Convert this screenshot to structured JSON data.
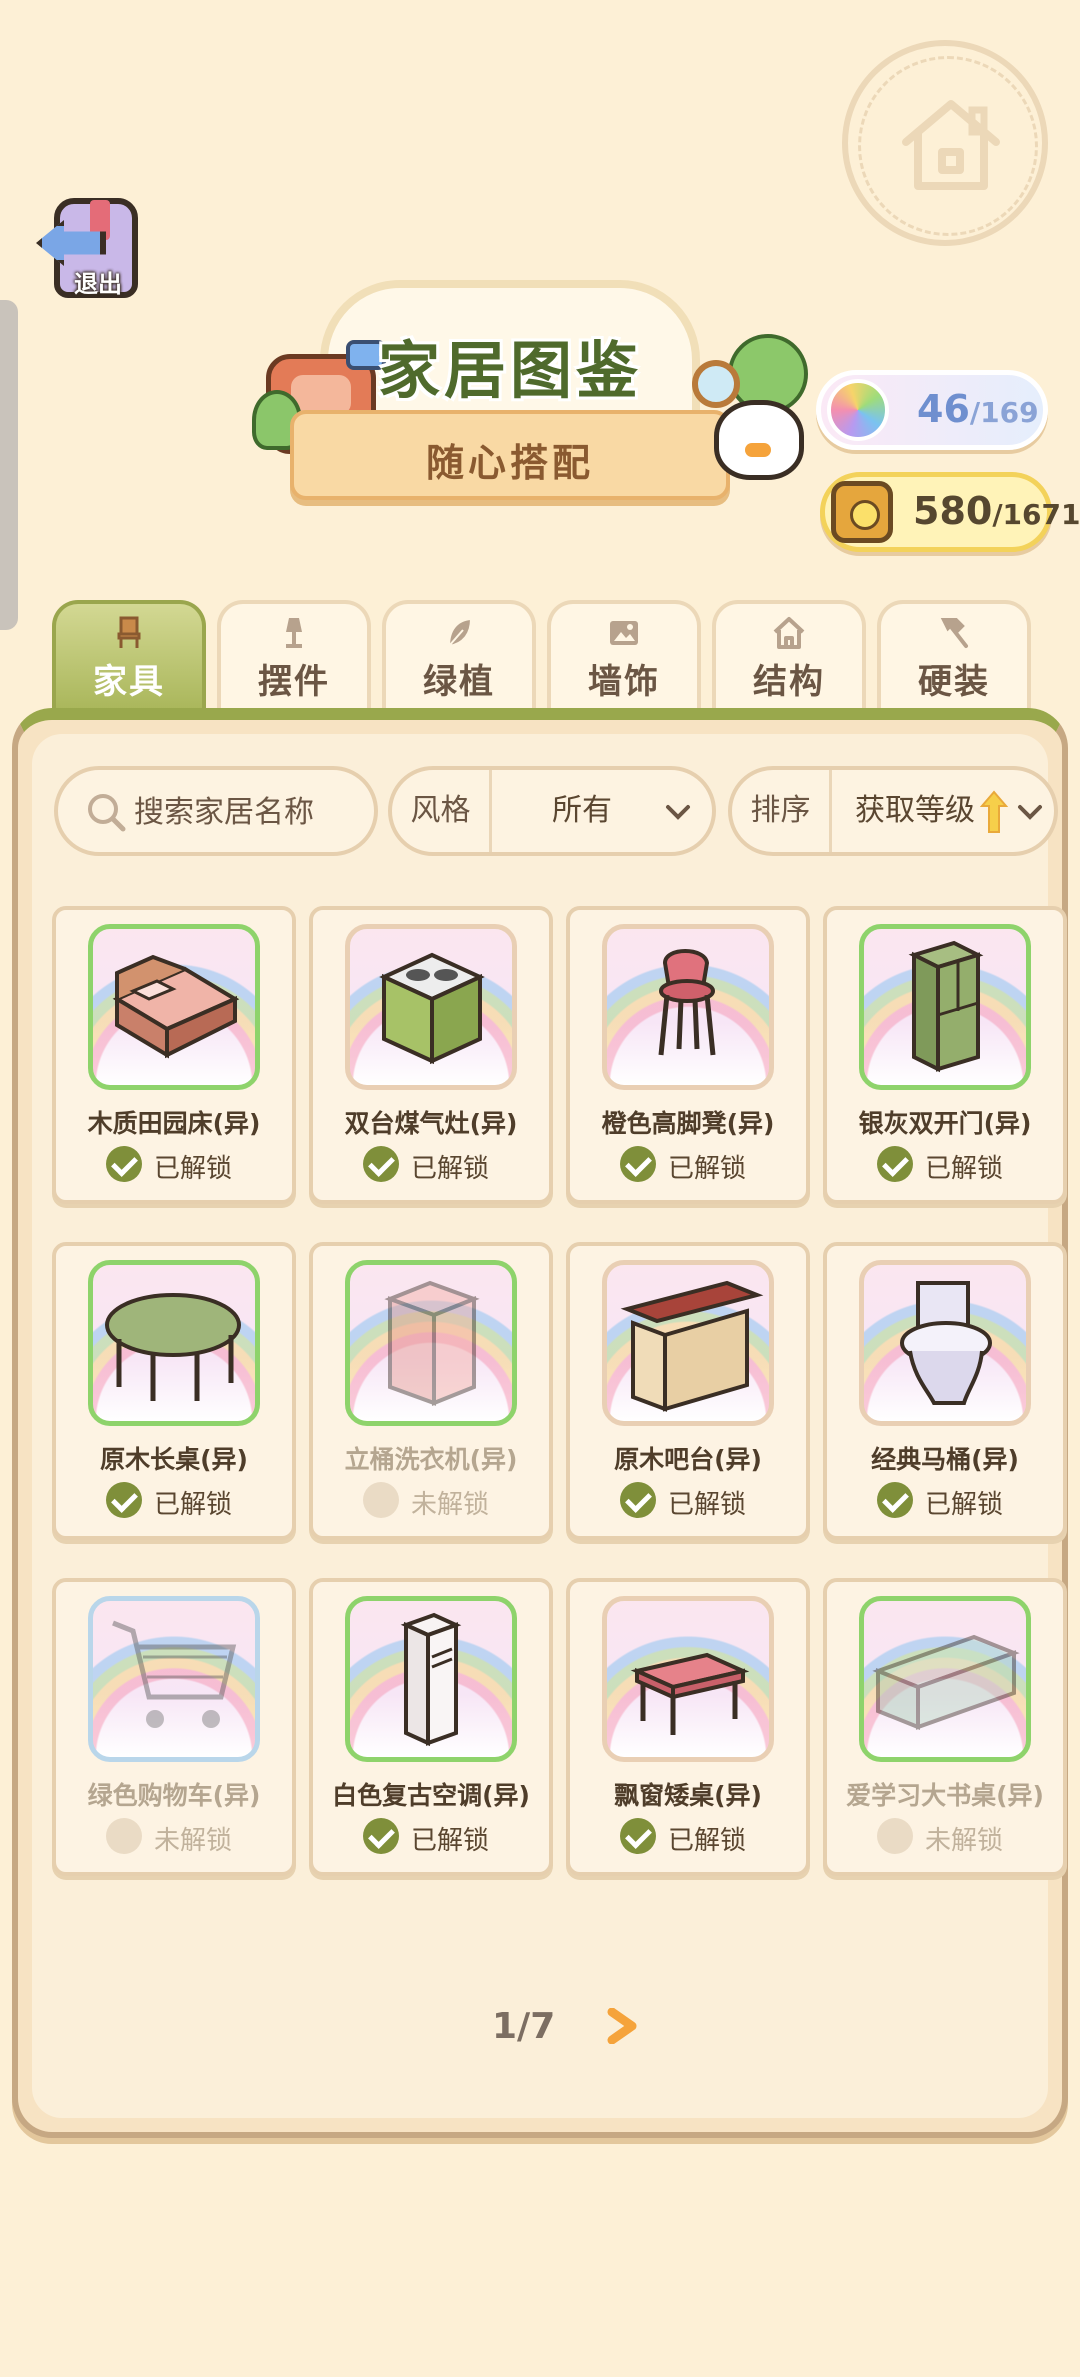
{
  "header": {
    "exit_label": "退出",
    "title": "家居图鉴",
    "subtitle": "随心搭配"
  },
  "counters": {
    "rainbow": {
      "value": "46",
      "total": "/169"
    },
    "coins": {
      "value": "580",
      "total": "/1671"
    }
  },
  "tabs": [
    {
      "label": "家具",
      "icon": "chair-icon",
      "active": true
    },
    {
      "label": "摆件",
      "icon": "lamp-icon",
      "active": false
    },
    {
      "label": "绿植",
      "icon": "leaf-icon",
      "active": false
    },
    {
      "label": "墙饰",
      "icon": "picture-frame-icon",
      "active": false
    },
    {
      "label": "结构",
      "icon": "house-icon",
      "active": false
    },
    {
      "label": "硬装",
      "icon": "hammer-icon",
      "active": false
    }
  ],
  "filters": {
    "search_placeholder": "搜索家居名称",
    "style_label": "风格",
    "style_value": "所有",
    "sort_label": "排序",
    "sort_value": "获取等级"
  },
  "items": [
    {
      "name": "木质田园床(异)",
      "status": "已解锁",
      "unlocked": true,
      "icon": "bed-icon"
    },
    {
      "name": "双台煤气灶(异)",
      "status": "已解锁",
      "unlocked": true,
      "icon": "stove-icon"
    },
    {
      "name": "橙色高脚凳(异)",
      "status": "已解锁",
      "unlocked": true,
      "icon": "stool-icon"
    },
    {
      "name": "银灰双开门(异)",
      "status": "已解锁",
      "unlocked": true,
      "icon": "fridge-icon"
    },
    {
      "name": "原木长桌(异)",
      "status": "已解锁",
      "unlocked": true,
      "icon": "table-icon"
    },
    {
      "name": "立桶洗衣机(异)",
      "status": "未解锁",
      "unlocked": false,
      "icon": "washing-machine-icon"
    },
    {
      "name": "原木吧台(异)",
      "status": "已解锁",
      "unlocked": true,
      "icon": "bar-counter-icon"
    },
    {
      "name": "经典马桶(异)",
      "status": "已解锁",
      "unlocked": true,
      "icon": "toilet-icon"
    },
    {
      "name": "绿色购物车(异)",
      "status": "未解锁",
      "unlocked": false,
      "icon": "shopping-cart-icon"
    },
    {
      "name": "白色复古空调(异)",
      "status": "已解锁",
      "unlocked": true,
      "icon": "air-conditioner-icon"
    },
    {
      "name": "飘窗矮桌(异)",
      "status": "已解锁",
      "unlocked": true,
      "icon": "low-table-icon"
    },
    {
      "name": "爱学习大书桌(异)",
      "status": "未解锁",
      "unlocked": false,
      "icon": "desk-icon"
    }
  ],
  "pagination": {
    "text": "1/7"
  },
  "colors": {
    "background": "#fdf0d6",
    "accent_green": "#a9b65a",
    "unlocked_check": "#7f8f3a",
    "next_arrow": "#f5a33b"
  }
}
